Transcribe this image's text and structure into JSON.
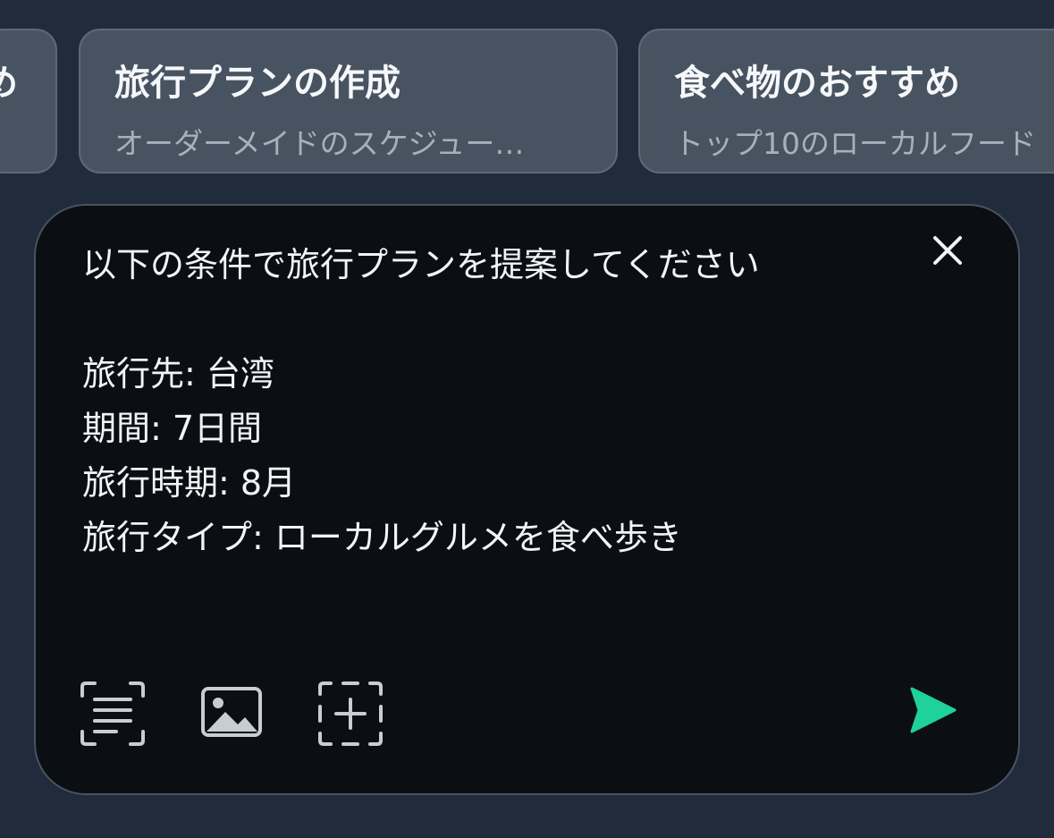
{
  "suggestions": [
    {
      "title": "め",
      "subtitle": ""
    },
    {
      "title": "旅行プランの作成",
      "subtitle": "オーダーメイドのスケジュー…"
    },
    {
      "title": "食べ物のおすすめ",
      "subtitle": "トップ10のローカルフード"
    }
  ],
  "composer": {
    "prompt": "以下の条件で旅行プランを提案してください\n\n旅行先: 台湾\n期間: 7日間\n旅行時期: 8月\n旅行タイプ: ローカルグルメを食べ歩き"
  },
  "icons": {
    "close": "close-icon",
    "text_scan": "text-scan-icon",
    "image": "image-icon",
    "add_frame": "add-frame-icon",
    "send": "send-icon"
  },
  "colors": {
    "background": "#202b3b",
    "card_bg": "#485361",
    "composer_bg": "#0b0f14",
    "accent_send": "#1fd19b",
    "text_primary": "#f2f4f7",
    "text_secondary": "#a9b0ba"
  }
}
